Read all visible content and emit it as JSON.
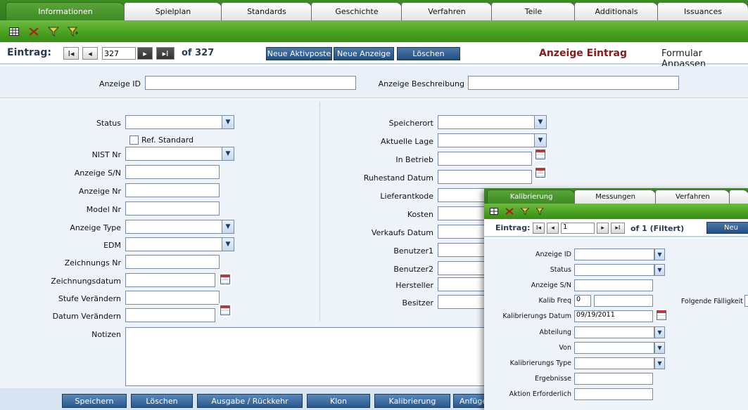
{
  "tabs": [
    "Informationen",
    "Spielplan",
    "Standards",
    "Geschichte",
    "Verfahren",
    "Teile",
    "Additionals",
    "Issuances"
  ],
  "toolbar_icons": [
    "grid-icon",
    "delete-filter-icon",
    "filter-icon",
    "filter-add-icon"
  ],
  "nav": {
    "label": "Eintrag:",
    "first": "I◂",
    "prev": "◂",
    "record": "327",
    "next": "▸",
    "last": "▸I",
    "of_total": "of 327"
  },
  "actions": [
    "Neue Aktivposte",
    "Neue Anzeige",
    "Löschen"
  ],
  "title": "Anzeige Eintrag",
  "form_adjust": "Formular Anpassen",
  "top_fields": {
    "anzeige_id": "Anzeige ID",
    "beschreibung": "Anzeige Beschreibung"
  },
  "left_fields": {
    "status": "Status",
    "ref_standard": "Ref. Standard",
    "nist_nr": "NIST Nr",
    "anzeige_sn": "Anzeige S/N",
    "anzeige_nr": "Anzeige Nr",
    "model_nr": "Model Nr",
    "anzeige_type": "Anzeige Type",
    "edm": "EDM",
    "zeichnungs_nr": "Zeichnungs Nr",
    "zeichnungsdatum": "Zeichnungsdatum",
    "stufe_veraendern": "Stufe Verändern",
    "datum_veraendern": "Datum Verändern"
  },
  "right_fields": {
    "speicherort": "Speicherort",
    "aktuelle_lage": "Aktuelle Lage",
    "in_betrieb": "In Betrieb",
    "ruhestand_datum": "Ruhestand Datum",
    "lieferantkode": "Lieferantkode",
    "kosten": "Kosten",
    "verkaufs_datum": "Verkaufs Datum",
    "benutzer1": "Benutzer1",
    "benutzer2": "Benutzer2",
    "hersteller": "Hersteller",
    "besitzer": "Besitzer"
  },
  "notizen": "Notizen",
  "bottom_buttons": [
    "Speichern",
    "Löschen",
    "Ausgabe / Rückkehr",
    "Klon",
    "Kalibrierung",
    "Anfüge"
  ],
  "overlay": {
    "tabs": [
      "Kalibrierung",
      "Messungen",
      "Verfahren"
    ],
    "nav": {
      "label": "Eintrag:",
      "first": "I◂",
      "prev": "◂",
      "record": "1",
      "next": "▸",
      "last": "▸I",
      "of_total": "of 1 (Filtert)"
    },
    "new_button": "Neu",
    "fields": {
      "anzeige_id": "Anzeige ID",
      "status": "Status",
      "anzeige_sn": "Anzeige S/N",
      "kalib_freq": "Kalib Freq",
      "kalib_freq_value": "0",
      "folgende": "Folgende Fälligkeit",
      "kalibrierungs_datum": "Kalibrierungs Datum",
      "kalibrierungs_datum_value": "09/19/2011",
      "abteilung": "Abteilung",
      "von": "Von",
      "kalibrierungs_type": "Kalibrierungs Type",
      "ergebnisse": "Ergebnisse",
      "aktion": "Aktion Erforderlich"
    }
  }
}
